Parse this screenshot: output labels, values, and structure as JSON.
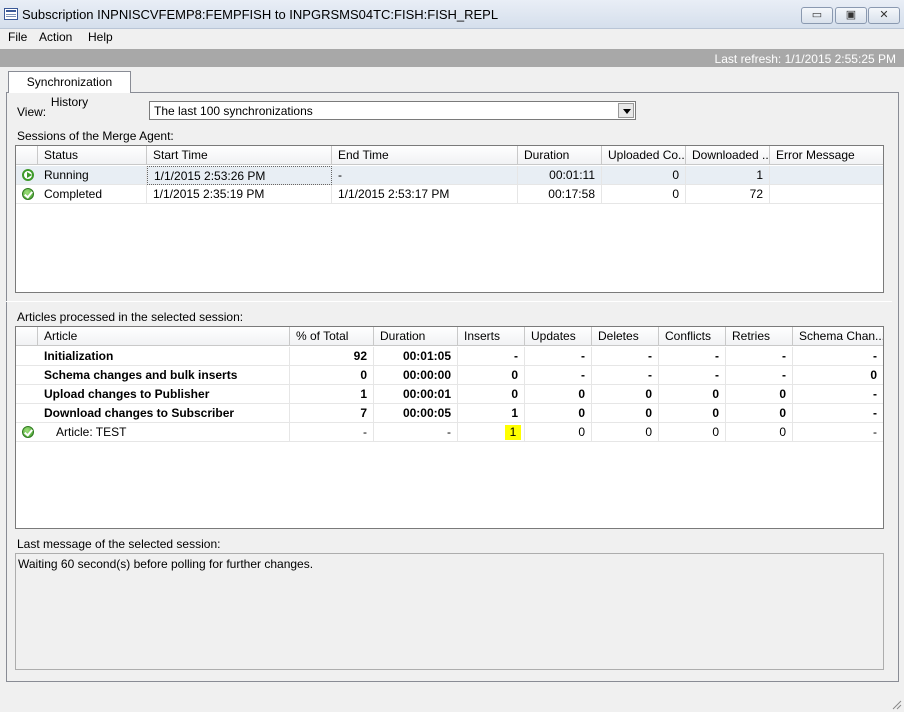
{
  "window": {
    "title": "Subscription INPNISCVFEMP8:FEMPFISH to INPGRSMS04TC:FISH:FISH_REPL",
    "minimize_glyph": "▭",
    "maximize_glyph": "▣",
    "close_glyph": "✕"
  },
  "menu": [
    "File",
    "Action",
    "Help"
  ],
  "refresh": "Last refresh: 1/1/2015 2:55:25 PM",
  "tab": "Synchronization History",
  "view": {
    "label": "View:",
    "selected": "The last 100 synchronizations"
  },
  "sessions": {
    "label": "Sessions of the Merge Agent:",
    "columns": [
      "Status",
      "Start Time",
      "End Time",
      "Duration",
      "Uploaded Co...",
      "Downloaded ...",
      "Error Message"
    ],
    "rows": [
      {
        "icon": "running-icon",
        "status": "Running",
        "start": "1/1/2015 2:53:26 PM",
        "end": "-",
        "duration": "00:01:11",
        "uploaded": "0",
        "downloaded": "1",
        "error": ""
      },
      {
        "icon": "completed-icon",
        "status": "Completed",
        "start": "1/1/2015 2:35:19 PM",
        "end": "1/1/2015 2:53:17 PM",
        "duration": "00:17:58",
        "uploaded": "0",
        "downloaded": "72",
        "error": ""
      }
    ]
  },
  "articles": {
    "label": "Articles processed in the selected session:",
    "columns": [
      "Article",
      "% of Total",
      "Duration",
      "Inserts",
      "Updates",
      "Deletes",
      "Conflicts",
      "Retries",
      "Schema Chan..."
    ],
    "rows": [
      {
        "name": "Initialization",
        "pct": "92",
        "duration": "00:01:05",
        "inserts": "-",
        "updates": "-",
        "deletes": "-",
        "conflicts": "-",
        "retries": "-",
        "schema": "-"
      },
      {
        "name": "Schema changes and bulk inserts",
        "pct": "0",
        "duration": "00:00:00",
        "inserts": "0",
        "updates": "-",
        "deletes": "-",
        "conflicts": "-",
        "retries": "-",
        "schema": "0"
      },
      {
        "name": "Upload changes to Publisher",
        "pct": "1",
        "duration": "00:00:01",
        "inserts": "0",
        "updates": "0",
        "deletes": "0",
        "conflicts": "0",
        "retries": "0",
        "schema": "-"
      },
      {
        "name": "Download changes to Subscriber",
        "pct": "7",
        "duration": "00:00:05",
        "inserts": "1",
        "updates": "0",
        "deletes": "0",
        "conflicts": "0",
        "retries": "0",
        "schema": "-"
      },
      {
        "name": "Article: TEST",
        "pct": "-",
        "duration": "-",
        "inserts": "1",
        "updates": "0",
        "deletes": "0",
        "conflicts": "0",
        "retries": "0",
        "schema": "-"
      }
    ]
  },
  "last_message": {
    "label": "Last message of the selected session:",
    "text": "Waiting 60 second(s) before polling for further changes."
  },
  "colors": {
    "highlight": "#ffff00",
    "refresh_bar": "#a8a8a8",
    "status_ok": "#3e9a2a"
  }
}
